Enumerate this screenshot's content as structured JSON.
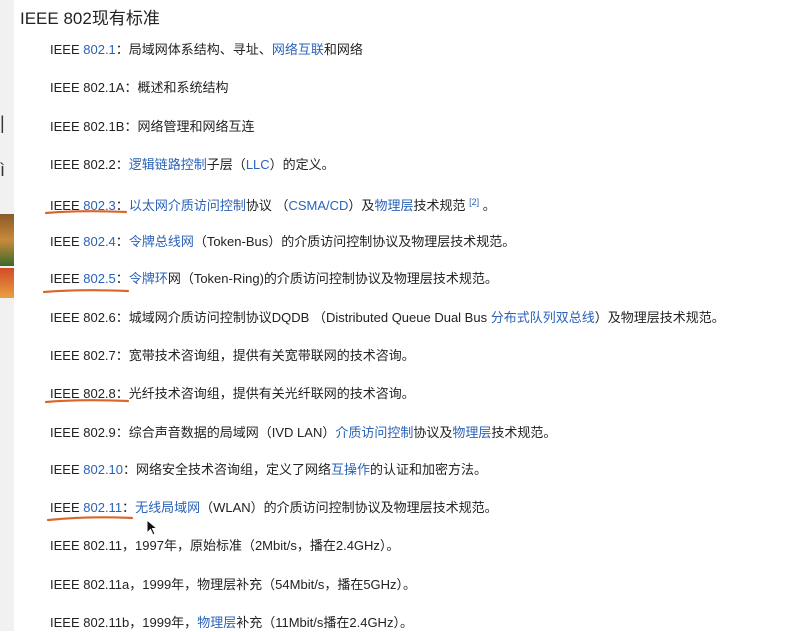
{
  "page": {
    "title": "IEEE 802现有标准"
  },
  "colors": {
    "link": "#2a62b8",
    "text": "#222222",
    "annotation": "#d9662a"
  },
  "standards": [
    {
      "segments": [
        {
          "t": "IEEE "
        },
        {
          "t": "802.1",
          "link": true
        },
        {
          "t": "：局域网体系结构、寻址、"
        },
        {
          "t": "网络互联",
          "link": true
        },
        {
          "t": "和网络"
        }
      ]
    },
    {
      "segments": [
        {
          "t": "IEEE 802.1A：概述和系统结构"
        }
      ]
    },
    {
      "segments": [
        {
          "t": "IEEE 802.1B：网络管理和网络互连"
        }
      ]
    },
    {
      "segments": [
        {
          "t": "IEEE 802.2："
        },
        {
          "t": "逻辑链路控制",
          "link": true
        },
        {
          "t": "子层（"
        },
        {
          "t": "LLC",
          "link": true
        },
        {
          "t": "）的定义。"
        }
      ]
    },
    {
      "segments": [
        {
          "t": "IEEE "
        },
        {
          "t": "802.3",
          "link": true
        },
        {
          "t": "："
        },
        {
          "t": "以太网",
          "link": true
        },
        {
          "t": "介质访问控制",
          "link": true
        },
        {
          "t": "协议 （"
        },
        {
          "t": "CSMA/CD",
          "link": true
        },
        {
          "t": "）及"
        },
        {
          "t": "物理层",
          "link": true
        },
        {
          "t": "技术规范 "
        },
        {
          "t": "[2]",
          "link": true,
          "sup": true
        },
        {
          "t": " 。"
        }
      ]
    },
    {
      "segments": [
        {
          "t": "IEEE "
        },
        {
          "t": "802.4",
          "link": true
        },
        {
          "t": "："
        },
        {
          "t": "令牌总线网",
          "link": true
        },
        {
          "t": "（Token-Bus）的介质访问控制协议及物理层技术规范。"
        }
      ]
    },
    {
      "segments": [
        {
          "t": "IEEE "
        },
        {
          "t": "802.5",
          "link": true
        },
        {
          "t": "："
        },
        {
          "t": "令牌环",
          "link": true
        },
        {
          "t": "网（Token-Ring)的介质访问控制协议及物理层技术规范。"
        }
      ]
    },
    {
      "segments": [
        {
          "t": "IEEE 802.6：城域网介质访问控制协议DQDB （Distributed Queue Dual Bus "
        },
        {
          "t": "分布式队列双总线",
          "link": true
        },
        {
          "t": "）及物理层技术规范。"
        }
      ]
    },
    {
      "segments": [
        {
          "t": "IEEE 802.7：宽带技术咨询组，提供有关宽带联网的技术咨询。"
        }
      ]
    },
    {
      "segments": [
        {
          "t": "IEEE 802.8：光纤技术咨询组，提供有关光纤联网的技术咨询。"
        }
      ]
    },
    {
      "segments": [
        {
          "t": "IEEE 802.9：综合声音数据的局域网（IVD LAN）"
        },
        {
          "t": "介质访问控制",
          "link": true
        },
        {
          "t": "协议及"
        },
        {
          "t": "物理层",
          "link": true
        },
        {
          "t": "技术规范。"
        }
      ]
    },
    {
      "segments": [
        {
          "t": "IEEE "
        },
        {
          "t": "802.10",
          "link": true
        },
        {
          "t": "：网络安全技术咨询组，定义了网络"
        },
        {
          "t": "互操作",
          "link": true
        },
        {
          "t": "的认证和加密方法。"
        }
      ]
    },
    {
      "segments": [
        {
          "t": "IEEE "
        },
        {
          "t": "802.11",
          "link": true
        },
        {
          "t": "："
        },
        {
          "t": "无线局域网",
          "link": true
        },
        {
          "t": "（WLAN）的介质访问控制协议及物理层技术规范。"
        }
      ]
    },
    {
      "segments": [
        {
          "t": "IEEE 802.11，1997年，原始标准（2Mbit/s，播在2.4GHz）。"
        }
      ]
    },
    {
      "segments": [
        {
          "t": "IEEE 802.11a，1999年，物理层补充（54Mbit/s，播在5GHz）。"
        }
      ]
    },
    {
      "segments": [
        {
          "t": "IEEE 802.11b，1999年，"
        },
        {
          "t": "物理层",
          "link": true
        },
        {
          "t": "补充（11Mbit/s播在2.4GHz）。"
        }
      ]
    }
  ]
}
